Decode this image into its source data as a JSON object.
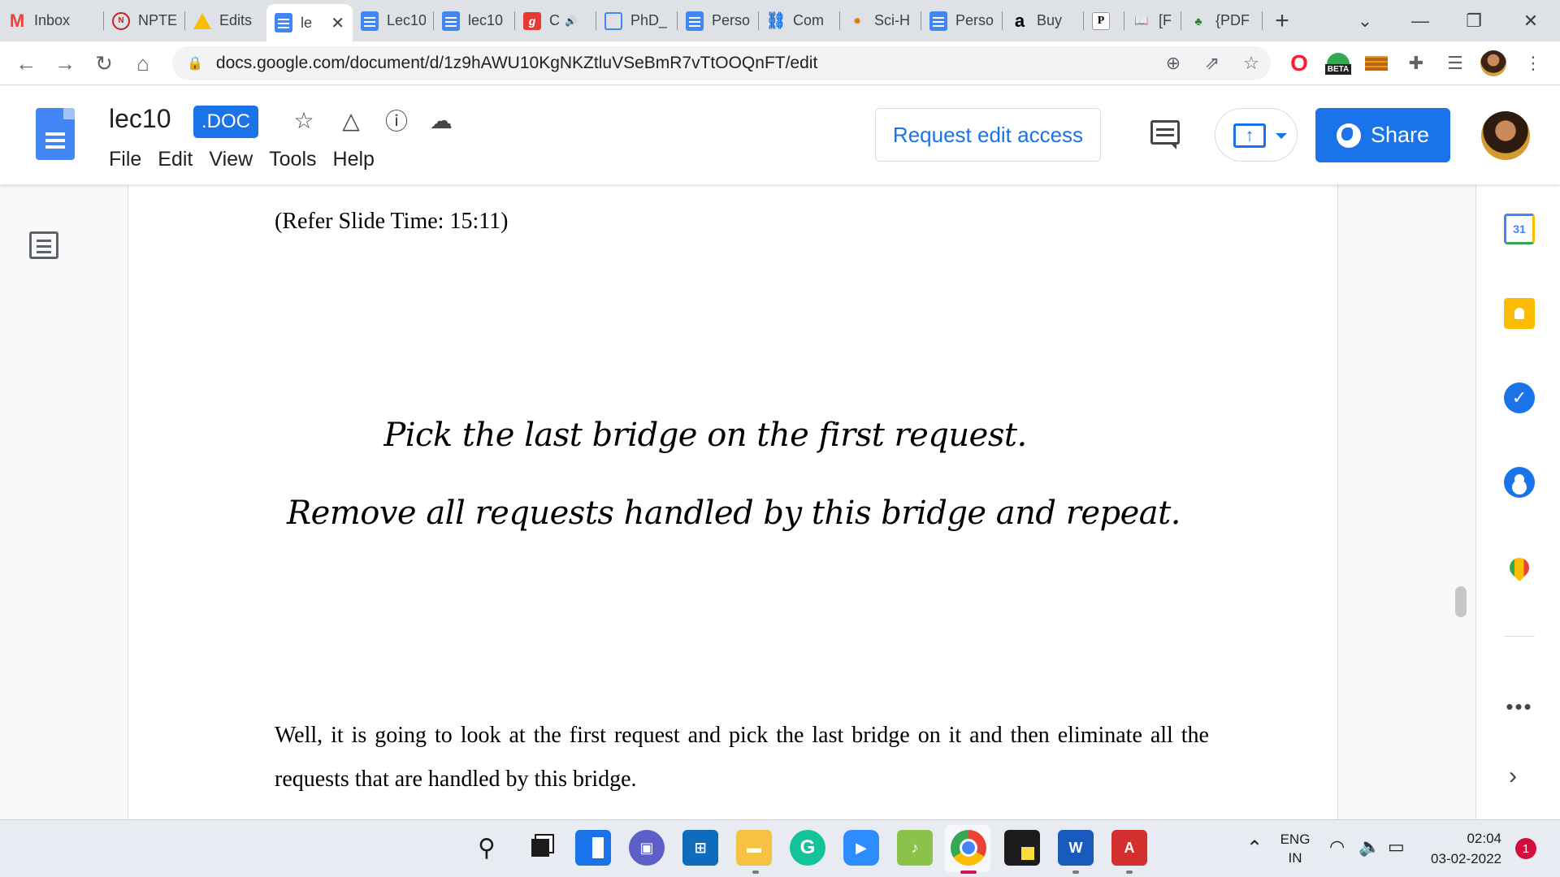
{
  "browser": {
    "tabs": [
      {
        "title": "Inbox",
        "icon": "gmail-icon",
        "fav": "M",
        "cls": "fav-gmail"
      },
      {
        "title": "NPTEL",
        "icon": "nptel-icon",
        "fav": "N",
        "cls": "fav-nptel"
      },
      {
        "title": "Edits",
        "icon": "drive-icon",
        "fav": "",
        "cls": "fav-drive"
      },
      {
        "title": "le",
        "icon": "docs-icon",
        "fav": "",
        "cls": "fav-docs",
        "active": true
      },
      {
        "title": "Lec10",
        "icon": "docs-icon",
        "fav": "",
        "cls": "fav-docs"
      },
      {
        "title": "lec10",
        "icon": "docs-icon",
        "fav": "",
        "cls": "fav-docs"
      },
      {
        "title": "C",
        "icon": "g-icon",
        "fav": "g",
        "cls": "fav-g",
        "audio": true
      },
      {
        "title": "PhD_",
        "icon": "file-icon",
        "fav": "",
        "cls": "fav-phd"
      },
      {
        "title": "Perso",
        "icon": "docs-icon",
        "fav": "",
        "cls": "fav-docs"
      },
      {
        "title": "Com",
        "icon": "link-icon",
        "fav": "⛓",
        "cls": "fav-link"
      },
      {
        "title": "Sci-H",
        "icon": "scihub-icon",
        "fav": "✹",
        "cls": "fav-scihub"
      },
      {
        "title": "Perso",
        "icon": "docs-icon",
        "fav": "",
        "cls": "fav-docs"
      },
      {
        "title": "Buy",
        "icon": "amazon-icon",
        "fav": "a",
        "cls": "fav-amazon"
      },
      {
        "title": "",
        "icon": "p-icon",
        "fav": "P",
        "cls": "fav-p"
      },
      {
        "title": "[F",
        "icon": "book-icon",
        "fav": "📖",
        "cls": "fav-book"
      },
      {
        "title": "{PDF",
        "icon": "pdf-site-icon",
        "fav": "♣",
        "cls": "fav-pdf"
      }
    ],
    "url": "docs.google.com/document/d/1z9hAWU10KgNKZtluVSeBmR7vTtOOQnFT/edit",
    "beta_label": "BETA"
  },
  "docs": {
    "title": "lec10",
    "badge": ".DOC",
    "menu": [
      "File",
      "Edit",
      "View",
      "Tools",
      "Help"
    ],
    "request_edit": "Request edit access",
    "share": "Share"
  },
  "document": {
    "slide_ref": "(Refer Slide Time: 15:11)",
    "handwriting_line1": "Pick the last bridge on the first request.",
    "handwriting_line2": "Remove all requests handled by this bridge and repeat.",
    "body": "Well, it is going to look at the first request and pick the last bridge on it and then eliminate all the requests that are handled by this bridge."
  },
  "sidepanel": {
    "calendar_day": "31"
  },
  "taskbar": {
    "lang_line1": "ENG",
    "lang_line2": "IN",
    "time": "02:04",
    "date": "03-02-2022",
    "notifications": "1"
  }
}
